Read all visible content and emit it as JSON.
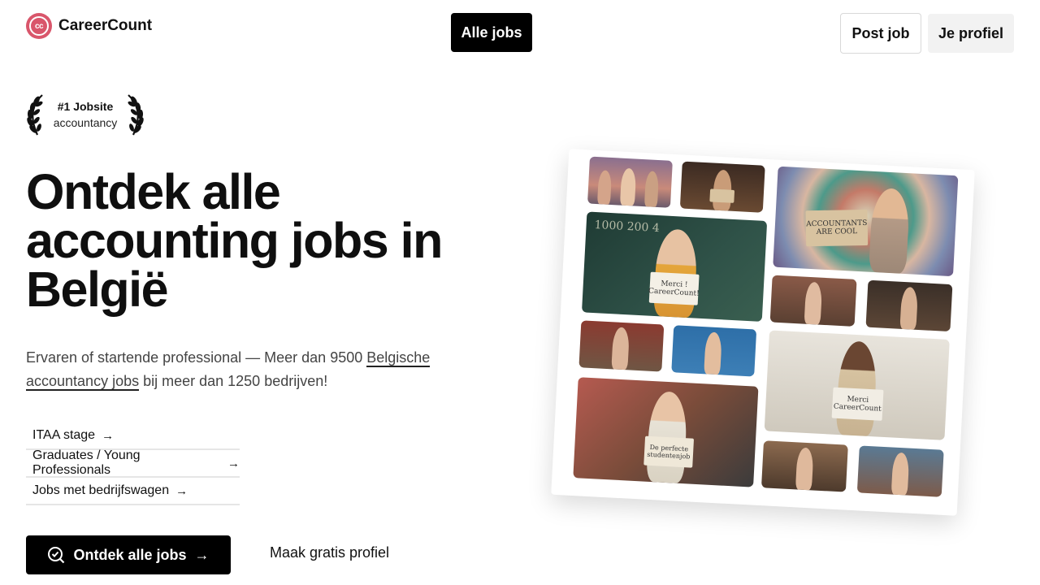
{
  "header": {
    "logo_initials": "cc",
    "logo_text": "CareerCount",
    "nav_all_jobs": "Alle jobs",
    "post_job": "Post job",
    "profile": "Je profiel"
  },
  "award": {
    "title": "#1 Jobsite",
    "subtitle": "accountancy"
  },
  "hero": {
    "title": "Ontdek alle accounting jobs in België",
    "subtitle_before": "Ervaren of startende professional — Meer dan 9500 ",
    "subtitle_link": "Belgische accountancy jobs",
    "subtitle_after": " bij meer dan 1250 bedrijven!"
  },
  "quick_links": [
    {
      "label": "ITAA stage",
      "icon": "arrow-right-icon"
    },
    {
      "label": "Graduates / Young Professionals",
      "icon": "arrow-right-icon"
    },
    {
      "label": "Jobs met bedrijfswagen",
      "icon": "arrow-right-icon"
    }
  ],
  "cta": {
    "main_label": "Ontdek alle jobs",
    "main_icon": "search-check-icon",
    "secondary_label": "Maak gratis profiel"
  },
  "collage": {
    "signs": {
      "accountants": "ACCOUNTANTS ARE COOL",
      "merci_1": "Merci ! CareerCount!",
      "merci_2": "Merci CareerCount",
      "perfect": "De perfecte studentenjob"
    }
  },
  "colors": {
    "brand": "#d9566b",
    "primary_button": "#000000",
    "secondary_button": "#f2f2f2"
  }
}
